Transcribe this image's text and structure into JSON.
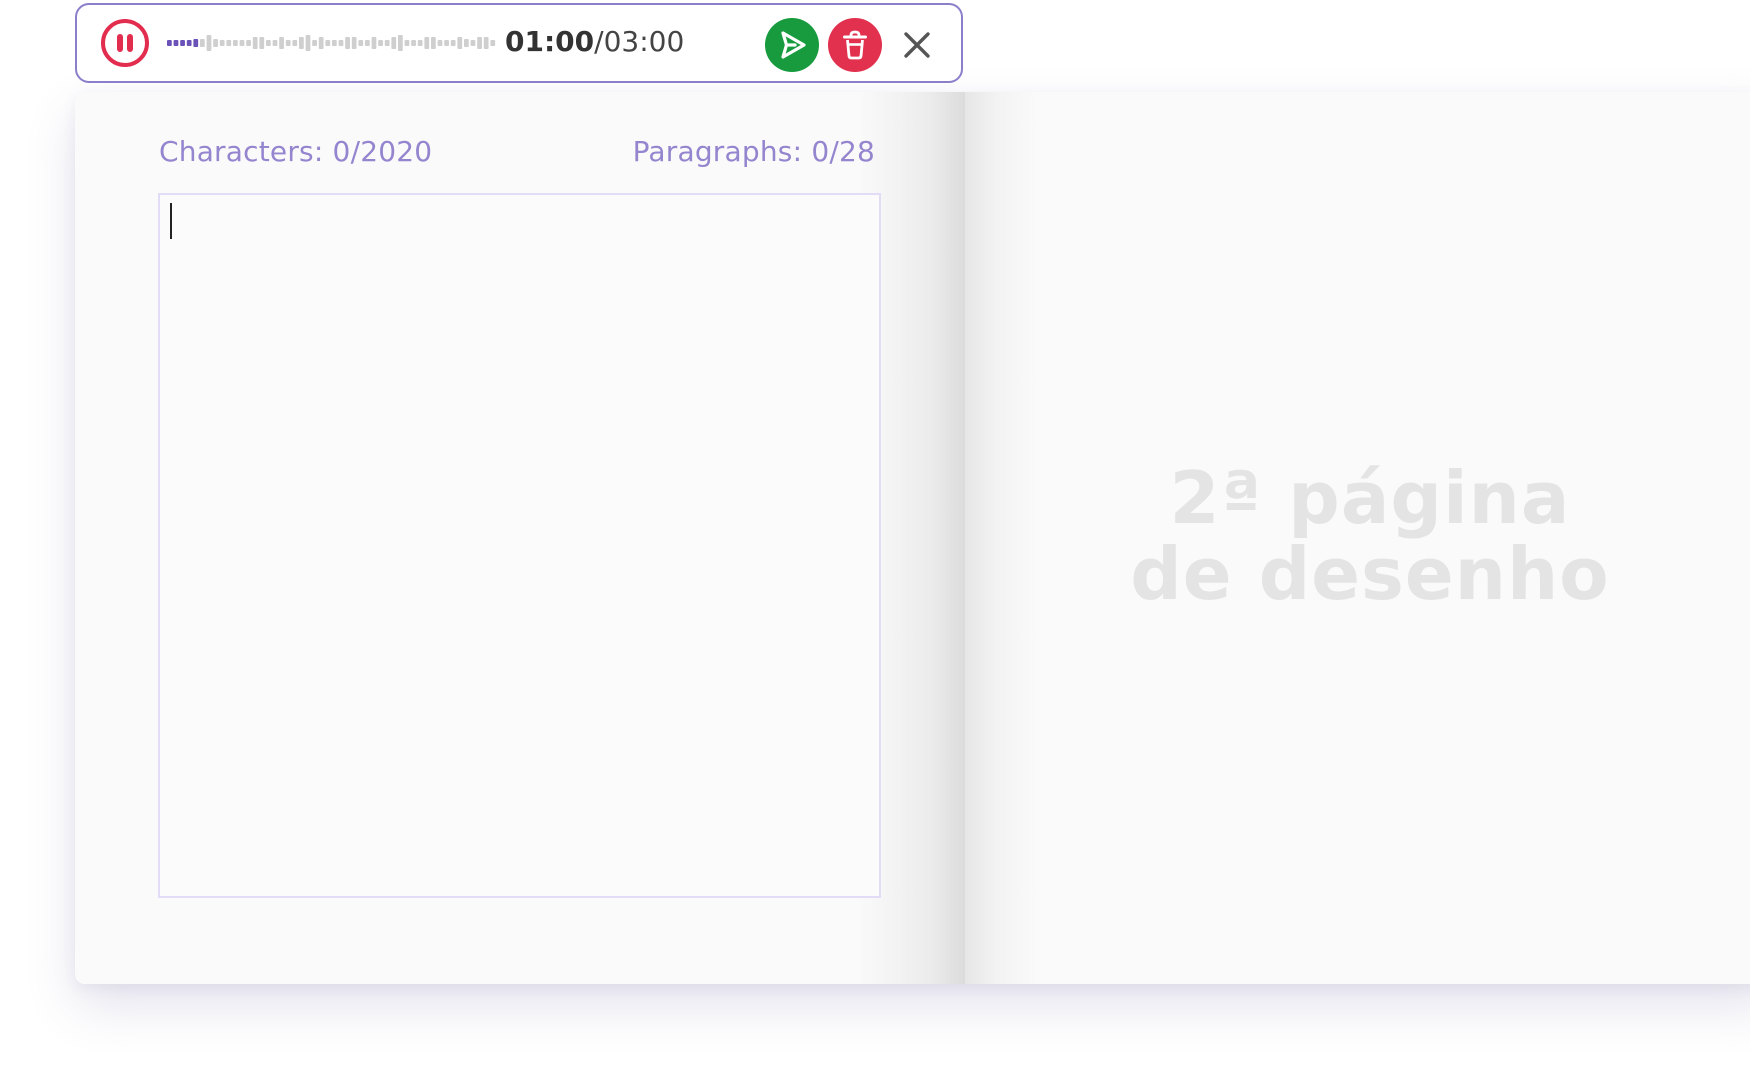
{
  "recorder": {
    "elapsed": "01:00",
    "separator": "/",
    "total": "03:00",
    "progress_fraction": 0.33,
    "colors": {
      "accent": "#e22d4f",
      "played_wave": "#6b52b8",
      "unplayed_wave": "#cfcfcf",
      "send": "#179b3e",
      "delete": "#e2314f",
      "border": "#8b7fcc"
    },
    "icons": {
      "pause": "pause-icon",
      "send": "send-icon",
      "delete": "trash-icon",
      "close": "close-icon"
    }
  },
  "editor": {
    "characters_label": "Characters: 0/2020",
    "paragraphs_label": "Paragraphs: 0/28",
    "text": ""
  },
  "drawing_page": {
    "line1": "2ª página",
    "line2": "de desenho"
  }
}
